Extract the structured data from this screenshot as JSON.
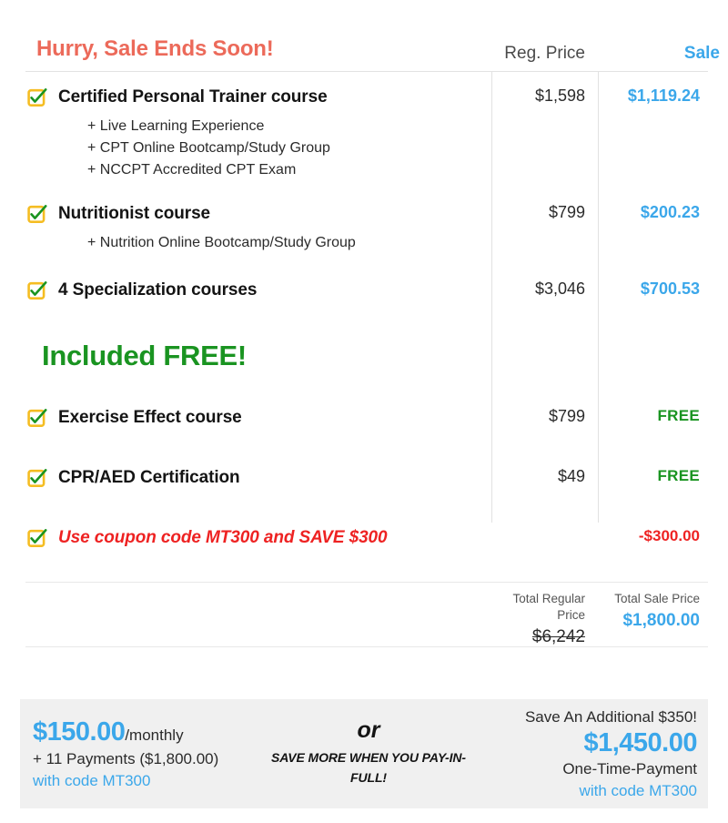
{
  "header": {
    "promo_title": "Hurry, Sale Ends Soon!",
    "col_regular": "Reg. Price",
    "col_sale": "Sale"
  },
  "colors": {
    "promo_red": "#ec6a5a",
    "sale_blue": "#3ba7ea",
    "free_green": "#1a9421",
    "coupon_red": "#ee2222",
    "checkbox_gold": "#f5bd22",
    "check_green": "#1a9421",
    "panel_bg": "#f0f0f0",
    "rule": "#e2e2e2"
  },
  "icons": {
    "checkbox": "checkbox-checked-icon"
  },
  "rows": [
    {
      "label": "Certified Personal Trainer course",
      "reg": "$1,598",
      "sale": "$1,119.24",
      "sale_style": "blue",
      "subitems": [
        "+ Live Learning Experience",
        "+ CPT Online Bootcamp/Study Group",
        "+ NCCPT Accredited CPT Exam"
      ]
    },
    {
      "label": "Nutritionist course",
      "reg": "$799",
      "sale": "$200.23",
      "sale_style": "blue",
      "subitems": [
        "+ Nutrition Online Bootcamp/Study Group"
      ]
    },
    {
      "label": "4 Specialization courses",
      "reg": "$3,046",
      "sale": "$700.53",
      "sale_style": "blue",
      "subitems": []
    },
    {
      "label": "Exercise Effect course",
      "reg": "$799",
      "sale": "FREE",
      "sale_style": "free",
      "subitems": []
    },
    {
      "label": "CPR/AED Certification",
      "reg": "$49",
      "sale": "FREE",
      "sale_style": "free",
      "subitems": []
    },
    {
      "label": "Use coupon code MT300 and SAVE $300",
      "reg": "",
      "sale": "-$300.00",
      "sale_style": "discount",
      "subitems": []
    }
  ],
  "free_banner": "Included FREE!",
  "totals": {
    "regular_label": "Total Regular Price",
    "regular_value": "$6,242",
    "sale_label": "Total Sale Price",
    "sale_value": "$1,800.00"
  },
  "panel": {
    "monthly_price": "$150.00",
    "monthly_suffix": "/monthly",
    "monthly_payments": "+ 11 Payments ($1,800.00)",
    "monthly_code": "with code MT300",
    "or": "or",
    "pay_in_full_note": "SAVE MORE WHEN YOU PAY-IN-FULL!",
    "save_additional": "Save An Additional $350!",
    "onetime_price": "$1,450.00",
    "onetime_label": "One-Time-Payment",
    "onetime_code": "with code MT300"
  }
}
